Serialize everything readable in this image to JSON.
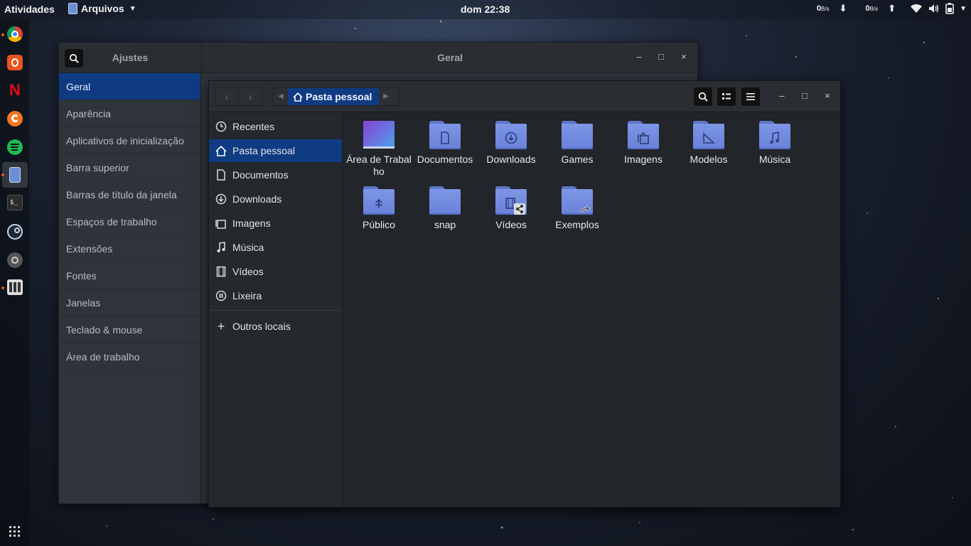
{
  "topbar": {
    "activities": "Atividades",
    "app_menu": "Arquivos",
    "clock": "dom 22:38",
    "down_speed": "0",
    "down_unit": "B/s",
    "up_speed": "0",
    "up_unit": "B/s"
  },
  "tweaks": {
    "search_title": "Ajustes",
    "main_title": "Geral",
    "items": [
      "Geral",
      "Aparência",
      "Aplicativos de inicialização",
      "Barra superior",
      "Barras de título da janela",
      "Espaços de trabalho",
      "Extensões",
      "Fontes",
      "Janelas",
      "Teclado & mouse",
      "Área de trabalho"
    ]
  },
  "files": {
    "breadcrumb": "Pasta pessoal",
    "places": [
      "Recentes",
      "Pasta pessoal",
      "Documentos",
      "Downloads",
      "Imagens",
      "Música",
      "Vídeos",
      "Lixeira"
    ],
    "other_places": "Outros locais",
    "items": [
      "Área de Trabalho",
      "Documentos",
      "Downloads",
      "Games",
      "Imagens",
      "Modelos",
      "Música",
      "Público",
      "snap",
      "Vídeos",
      "Exemplos"
    ]
  },
  "colors": {
    "accent": "#0f3b82",
    "folder": "#7d96e6",
    "window_bg": "#22252a"
  }
}
